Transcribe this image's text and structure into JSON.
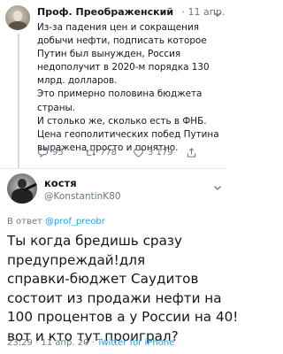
{
  "parent_tweet": {
    "author_name": "Проф. Преображенский",
    "date": "11 апр.",
    "text_lines": [
      "Из-за падения цен и сокращения",
      "добычи нефти, подписать которое",
      "Путин был вынужден, Россия",
      "недополучит в 2020-м порядка 130",
      "млрд. долларов.",
      "Это примерно половина бюджета",
      "страны.",
      "И столько же, сколько есть в ФНБ.",
      "Цена геополитических побед Путина",
      "выражена просто и понятно."
    ],
    "replies": "95",
    "retweets": "778",
    "likes": "3 179"
  },
  "main_tweet": {
    "author_name": "костя",
    "handle": "@KonstantinK80",
    "replying_prefix": "В ответ",
    "replying_to": "@prof_preobr",
    "text_lines": [
      "Ты когда бредишь сразу",
      "предупреждай!для",
      "справки-бюджет Саудитов",
      "состоит из продажи нефти на",
      "100 процентов а у России на 40!",
      "вот и кто тут проиграл?"
    ],
    "time": "23:29",
    "date": "11 апр. 20",
    "client": "Twitter for iPhone"
  },
  "icons": {
    "caret": "chevron-down-icon",
    "reply": "reply-icon",
    "retweet": "retweet-icon",
    "like": "heart-icon",
    "share": "share-icon"
  },
  "colors": {
    "accent": "#1da1f2",
    "muted": "#657786",
    "text": "#14171a"
  }
}
